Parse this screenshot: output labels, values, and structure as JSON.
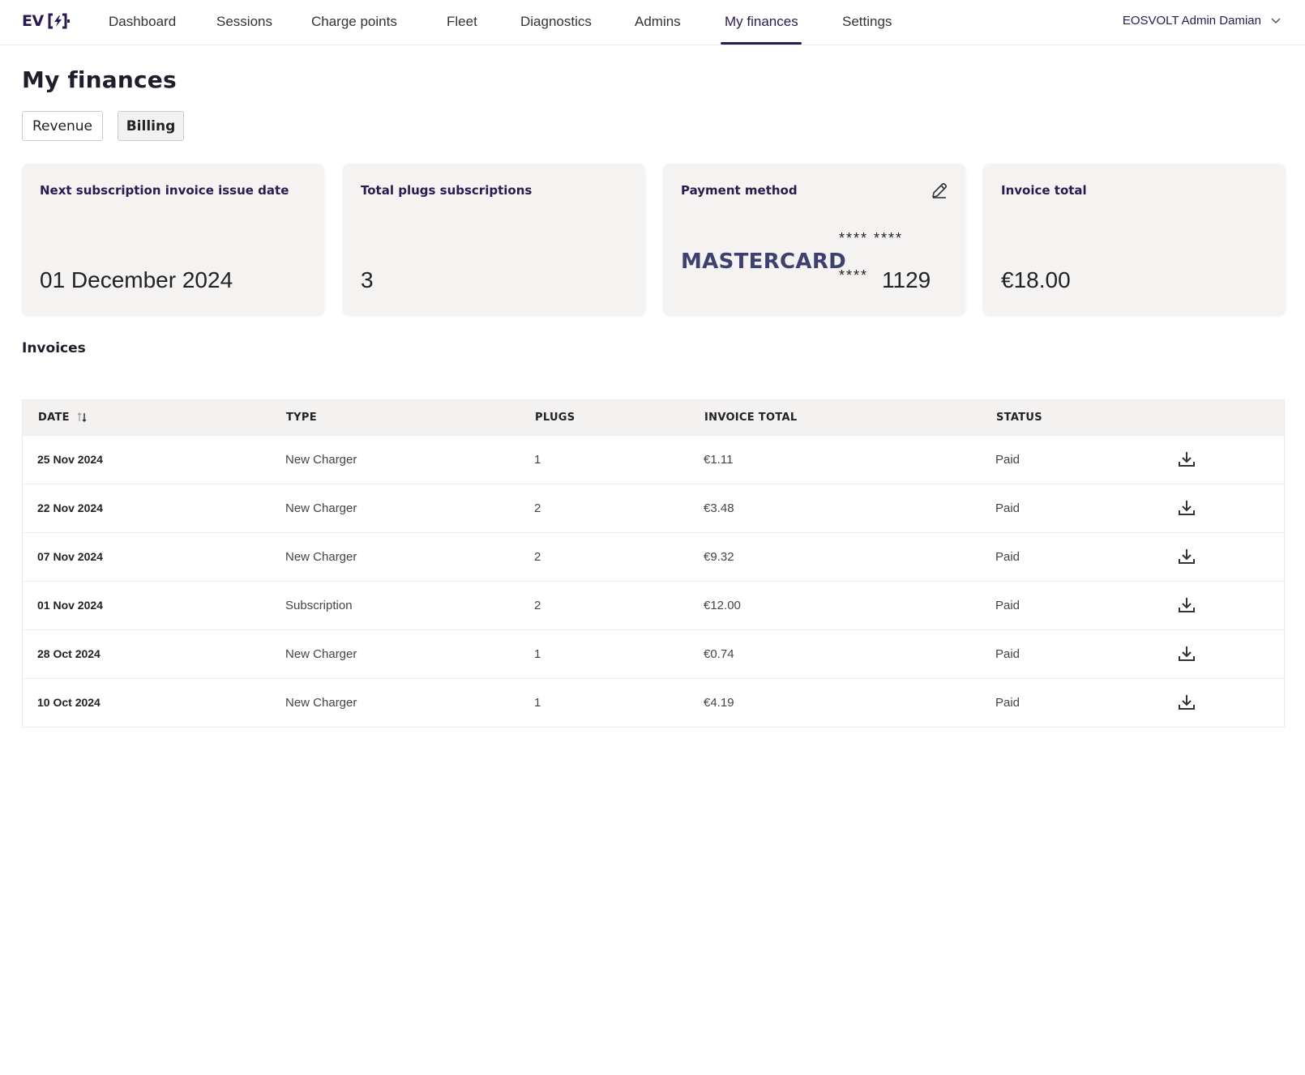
{
  "logo": {
    "text": "EV"
  },
  "nav": {
    "items": [
      {
        "label": "Dashboard"
      },
      {
        "label": "Sessions"
      },
      {
        "label": "Charge points"
      },
      {
        "label": "Fleet"
      },
      {
        "label": "Diagnostics"
      },
      {
        "label": "Admins"
      },
      {
        "label": "My finances"
      },
      {
        "label": "Settings"
      }
    ],
    "active": "My finances",
    "user": "EOSVOLT Admin Damian"
  },
  "page": {
    "title": "My finances",
    "tabs": [
      {
        "label": "Revenue"
      },
      {
        "label": "Billing"
      }
    ],
    "active_tab": "Billing"
  },
  "cards": {
    "next_invoice": {
      "title": "Next subscription invoice issue date",
      "value": "01 December 2024"
    },
    "plugs": {
      "title": "Total plugs subscriptions",
      "value": "3"
    },
    "payment": {
      "title": "Payment method",
      "brand": "MASTERCARD",
      "mask_top": "**** ****",
      "mask_bottom": "****",
      "last4": "1129",
      "edit_icon": "pencil-icon"
    },
    "invoice_total": {
      "title": "Invoice total",
      "value": "€18.00"
    }
  },
  "invoices": {
    "title": "Invoices",
    "columns": {
      "date": "DATE",
      "type": "TYPE",
      "plugs": "PLUGS",
      "total": "INVOICE TOTAL",
      "status": "STATUS"
    },
    "rows": [
      {
        "date": "25 Nov 2024",
        "type": "New Charger",
        "plugs": "1",
        "total": "€1.11",
        "status": "Paid"
      },
      {
        "date": "22 Nov 2024",
        "type": "New Charger",
        "plugs": "2",
        "total": "€3.48",
        "status": "Paid"
      },
      {
        "date": "07 Nov 2024",
        "type": "New Charger",
        "plugs": "2",
        "total": "€9.32",
        "status": "Paid"
      },
      {
        "date": "01 Nov 2024",
        "type": "Subscription",
        "plugs": "2",
        "total": "€12.00",
        "status": "Paid"
      },
      {
        "date": "28 Oct 2024",
        "type": "New Charger",
        "plugs": "1",
        "total": "€0.74",
        "status": "Paid"
      },
      {
        "date": "10 Oct 2024",
        "type": "New Charger",
        "plugs": "1",
        "total": "€4.19",
        "status": "Paid"
      }
    ]
  },
  "colors": {
    "brand": "#2a1a4f",
    "card_bg": "#f5f2f2",
    "mastercard": "#3e4170"
  }
}
